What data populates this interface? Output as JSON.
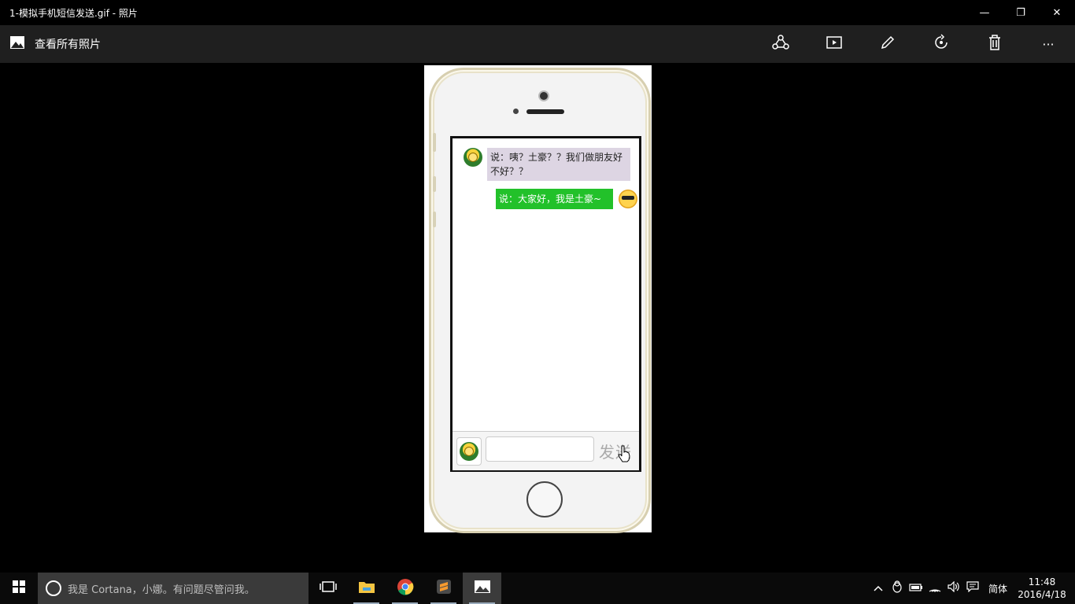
{
  "window": {
    "title": "1-模拟手机短信发送.gif - 照片",
    "minimize_glyph": "—",
    "restore_glyph": "❐",
    "close_glyph": "✕"
  },
  "toolbar": {
    "back_label": "查看所有照片",
    "actions": [
      "share-icon",
      "slideshow-icon",
      "edit-icon",
      "rotate-icon",
      "delete-icon",
      "more-icon"
    ],
    "more_glyph": "···"
  },
  "chat": {
    "messages": [
      {
        "side": "left",
        "text": "说：咦？土豪？？我们做朋友好不好？？",
        "avatar": "turtle-avatar"
      },
      {
        "side": "right",
        "text": "说：大家好，我是土豪~",
        "avatar": "cool-face-avatar"
      }
    ],
    "input_value": "",
    "send_label": "发送",
    "colors": {
      "left_bubble": "#ddd5e3",
      "right_bubble": "#22c12a"
    }
  },
  "taskbar": {
    "search_placeholder": "我是 Cortana，小娜。有问题尽管问我。",
    "apps": [
      "task-view-icon",
      "file-explorer-icon",
      "chrome-icon",
      "sublime-text-icon",
      "photos-icon"
    ],
    "ime_label": "简体",
    "time": "11:48",
    "date": "2016/4/18"
  }
}
